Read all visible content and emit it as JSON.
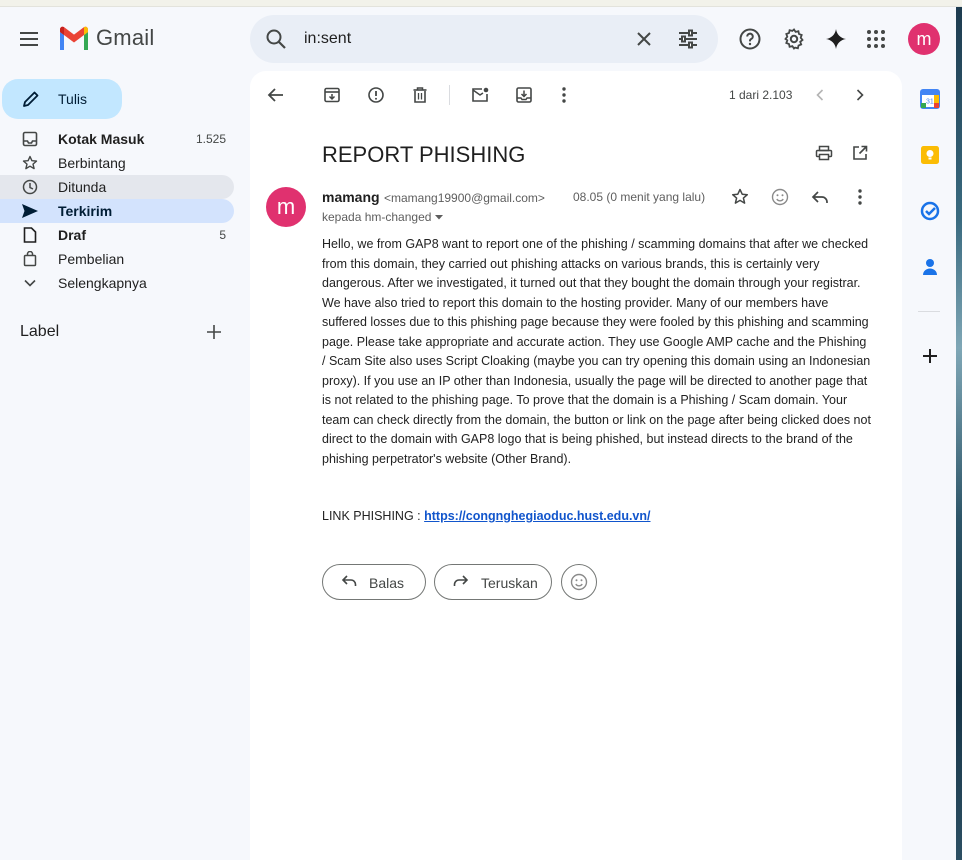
{
  "app": {
    "logo_text": "Gmail"
  },
  "search": {
    "query": "in:sent"
  },
  "user": {
    "avatar_letter": "m"
  },
  "sidebar": {
    "compose_label": "Tulis",
    "items": [
      {
        "label": "Kotak Masuk",
        "count": "1.525"
      },
      {
        "label": "Berbintang",
        "count": ""
      },
      {
        "label": "Ditunda",
        "count": ""
      },
      {
        "label": "Terkirim",
        "count": ""
      },
      {
        "label": "Draf",
        "count": "5"
      },
      {
        "label": "Pembelian",
        "count": ""
      },
      {
        "label": "Selengkapnya",
        "count": ""
      }
    ],
    "labels_title": "Label"
  },
  "toolbar": {
    "pager": "1 dari 2.103"
  },
  "email": {
    "subject": "REPORT PHISHING",
    "sender_initial": "m",
    "sender_name": "mamang",
    "sender_email": "<mamang19900@gmail.com>",
    "time": "08.05 (0 menit yang lalu)",
    "to_line": "kepada hm-changed",
    "body": "  Hello, we from GAP8 want to report one of the phishing / scamming domains that after we checked from this domain, they carried out phishing attacks on various brands, this is certainly very dangerous. After we investigated, it turned out that they bought the domain through your registrar. We have also tried to report this domain to the hosting provider. Many of our members have suffered losses due to this phishing page because they were fooled by this phishing and scamming page. Please take appropriate and accurate action. They use Google AMP cache and the Phishing / Scam Site also uses Script Cloaking (maybe you can try opening this domain using an Indonesian proxy). If you use an IP other than Indonesia, usually the page will be directed to another page that is not related to the phishing page. To prove that the domain is a Phishing / Scam domain. Your team can check directly from the domain, the button or link on the page after being clicked does not direct to the domain with GAP8 logo that is being phished, but instead directs to the brand of the phishing perpetrator's website (Other Brand).",
    "link_prefix": "LINK PHISHING : ",
    "link_text": "https://congnghegiaoduc.hust.edu.vn/",
    "reply_label": "Balas",
    "forward_label": "Teruskan"
  },
  "colors": {
    "accent": "#0b57d0",
    "avatar": "#e0316f",
    "compose": "#c2e7ff",
    "active_nav": "#d3e3fd"
  }
}
